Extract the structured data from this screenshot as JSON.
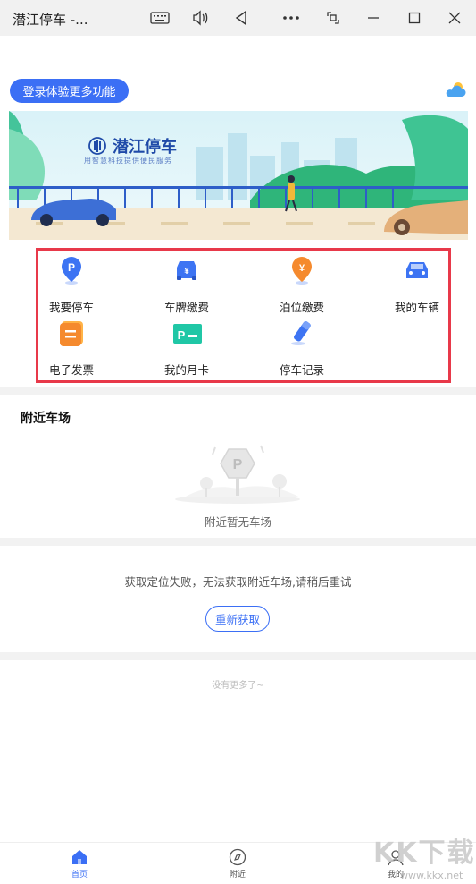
{
  "window": {
    "title": "潜江停车 -..."
  },
  "header": {
    "login_label": "登录体验更多功能",
    "weather_icon": "cloud-sun-icon"
  },
  "banner": {
    "brand_name": "潜江停车",
    "tagline": "用智慧科技提供便民服务"
  },
  "functions": [
    {
      "label": "我要停车",
      "icon": "parking-pin-icon"
    },
    {
      "label": "车牌缴费",
      "icon": "car-yuan-icon"
    },
    {
      "label": "泊位缴费",
      "icon": "yuan-pin-icon"
    },
    {
      "label": "我的车辆",
      "icon": "car-icon"
    },
    {
      "label": "电子发票",
      "icon": "invoice-icon"
    },
    {
      "label": "我的月卡",
      "icon": "monthly-card-icon"
    },
    {
      "label": "停车记录",
      "icon": "record-pen-icon"
    }
  ],
  "nearby": {
    "title": "附近车场",
    "empty_text": "附近暂无车场"
  },
  "location": {
    "fail_text": "获取定位失败，无法获取附近车场,请稍后重试",
    "retry_label": "重新获取"
  },
  "footer": {
    "no_more": "没有更多了~"
  },
  "nav": [
    {
      "label": "首页",
      "icon": "home-icon",
      "active": true
    },
    {
      "label": "附近",
      "icon": "compass-icon",
      "active": false
    },
    {
      "label": "我的",
      "icon": "user-icon",
      "active": false
    }
  ],
  "watermark": {
    "big": "KK下载",
    "small": "www.kkx.net"
  },
  "colors": {
    "accent": "#3b6ff5",
    "highlight_border": "#e8394a"
  }
}
